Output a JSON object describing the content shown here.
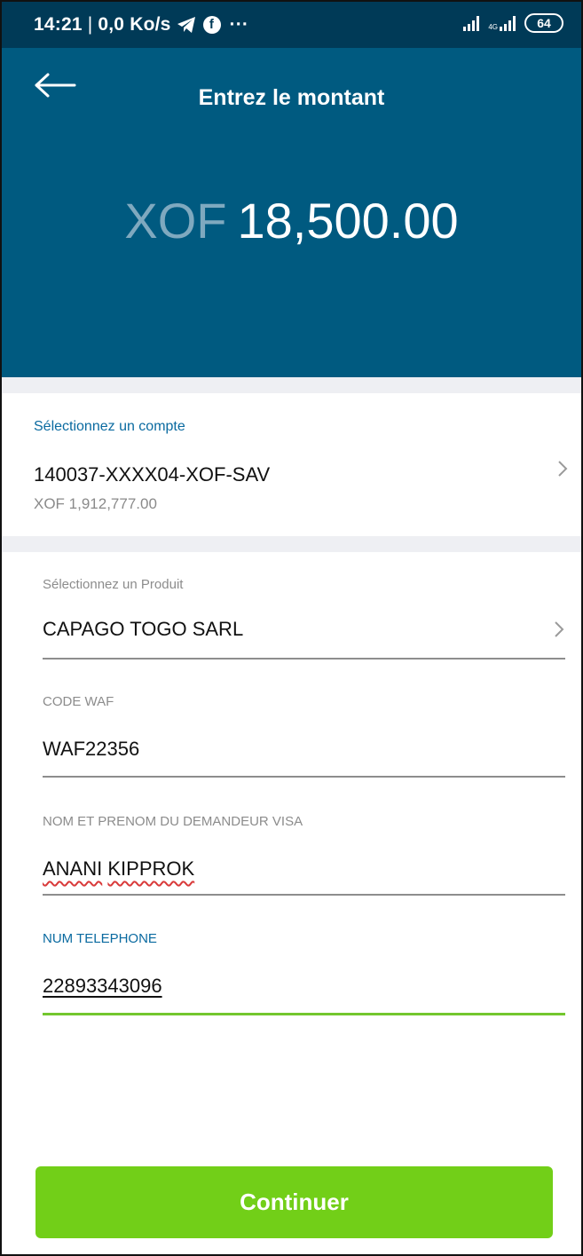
{
  "status_bar": {
    "time": "14:21",
    "net_speed": "0,0 Ko/s",
    "more": "···",
    "network_type": "4G",
    "battery": "64",
    "icons": [
      "telegram-icon",
      "facebook-icon",
      "signal-icon",
      "4g-signal-icon",
      "battery-icon"
    ]
  },
  "header": {
    "title": "Entrez le montant",
    "currency": "XOF",
    "amount": "18,500.00"
  },
  "account": {
    "label": "Sélectionnez un compte",
    "number": "140037-XXXX04-XOF-SAV",
    "balance": "XOF 1,912,777.00"
  },
  "form": {
    "product": {
      "label": "Sélectionnez un Produit",
      "value": "CAPAGO TOGO SARL"
    },
    "code_waf": {
      "label": "CODE WAF",
      "value": "WAF22356"
    },
    "name": {
      "label": "NOM ET PRENOM DU DEMANDEUR VISA",
      "value_first": "ANANI",
      "value_last": "KIPPROK"
    },
    "phone": {
      "label": "NUM TELEPHONE",
      "value": "22893343096"
    }
  },
  "actions": {
    "continue_label": "Continuer"
  },
  "colors": {
    "header_bg": "#005a80",
    "statusbar_bg": "#003a57",
    "accent_label": "#0a6aa0",
    "button_green": "#72cf18",
    "active_line": "#73c72e"
  }
}
